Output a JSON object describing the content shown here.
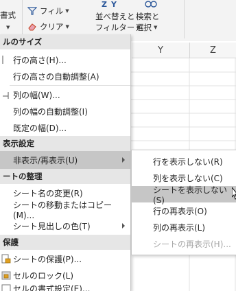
{
  "ribbon": {
    "format_label": "書式",
    "filter_label": "フィル",
    "clear_label": "クリア",
    "sort_filter_line1": "並べ替えと",
    "sort_filter_line2": "フィルター",
    "find_select_line1": "検索と",
    "find_select_line2": "選択",
    "sort_icon_letters": "ZY"
  },
  "sheet": {
    "columns": [
      "Y",
      "Z"
    ]
  },
  "menu": {
    "sections": {
      "cell_size": "ルのサイズ",
      "visibility": "表示設定",
      "organize": "ートの整理",
      "protection": "保護"
    },
    "items": {
      "row_height": "行の高さ(H)...",
      "autofit_row_height": "行の高さの自動調整(A)",
      "column_width": "列の幅(W)...",
      "autofit_column_width": "列の幅の自動調整(I)",
      "default_width": "既定の幅(D)...",
      "hide_unhide": "非表示/再表示(U)",
      "rename_sheet": "シート名の変更(R)",
      "move_copy_sheet": "シートの移動またはコピー(M)...",
      "tab_color": "シート見出しの色(T)",
      "protect_sheet": "シートの保護(P)...",
      "lock_cell": "セルのロック(L)",
      "format_cells": "セルの書式設定(E)..."
    }
  },
  "submenu": {
    "items": [
      {
        "label": "行を表示しない(R)",
        "highlighted": false,
        "disabled": false
      },
      {
        "label": "列を表示しない(C)",
        "highlighted": false,
        "disabled": false
      },
      {
        "label": "シートを表示しない(S)",
        "highlighted": true,
        "disabled": false
      },
      {
        "label": "行の再表示(O)",
        "highlighted": false,
        "disabled": false
      },
      {
        "label": "列の再表示(L)",
        "highlighted": false,
        "disabled": false
      },
      {
        "label": "シートの再表示(H)...",
        "highlighted": false,
        "disabled": true
      }
    ]
  },
  "colors": {
    "highlight": "#c6c6c6",
    "section_bg": "#e6e6e6",
    "ribbon_bg": "#f3f3f3",
    "disabled_text": "#a6a6a6",
    "icon_blue": "#2b579a",
    "icon_red": "#c43e1c"
  }
}
